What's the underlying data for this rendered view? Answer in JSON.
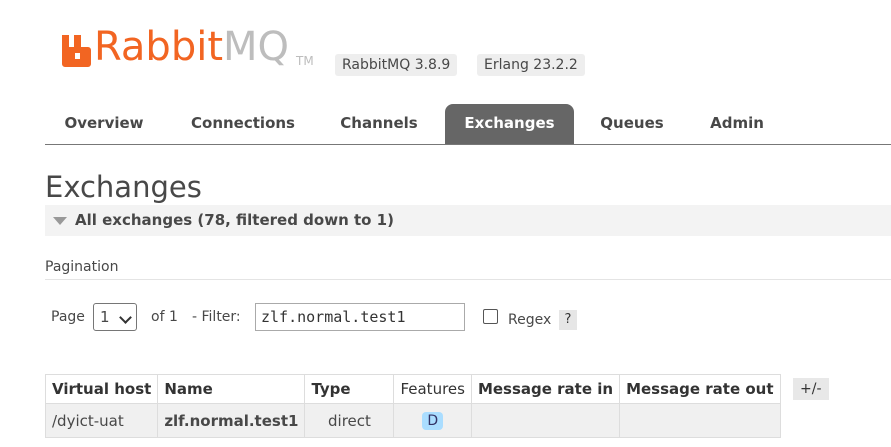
{
  "header": {
    "logo_brand": "Rabbit",
    "logo_product": "MQ",
    "trademark": "TM",
    "version": "RabbitMQ 3.8.9",
    "erlang": "Erlang 23.2.2",
    "accent_color": "#f26522"
  },
  "tabs": [
    {
      "label": "Overview",
      "active": false
    },
    {
      "label": "Connections",
      "active": false
    },
    {
      "label": "Channels",
      "active": false
    },
    {
      "label": "Exchanges",
      "active": true
    },
    {
      "label": "Queues",
      "active": false
    },
    {
      "label": "Admin",
      "active": false
    }
  ],
  "page": {
    "title": "Exchanges",
    "section_label": "All exchanges (78, filtered down to 1)"
  },
  "pagination": {
    "label": "Pagination",
    "page_label": "Page",
    "page_value": "1",
    "of_label": "of 1",
    "filter_label": "- Filter:",
    "filter_value": "zlf.normal.test1",
    "regex_label": "Regex",
    "regex_checked": false,
    "help": "?"
  },
  "table": {
    "columns": [
      "Virtual host",
      "Name",
      "Type",
      "Features",
      "Message rate in",
      "Message rate out"
    ],
    "rows": [
      {
        "vhost": "/dyict-uat",
        "name": "zlf.normal.test1",
        "type": "direct",
        "features": "D",
        "rate_in": "",
        "rate_out": ""
      }
    ],
    "toggle_columns": "+/-"
  }
}
